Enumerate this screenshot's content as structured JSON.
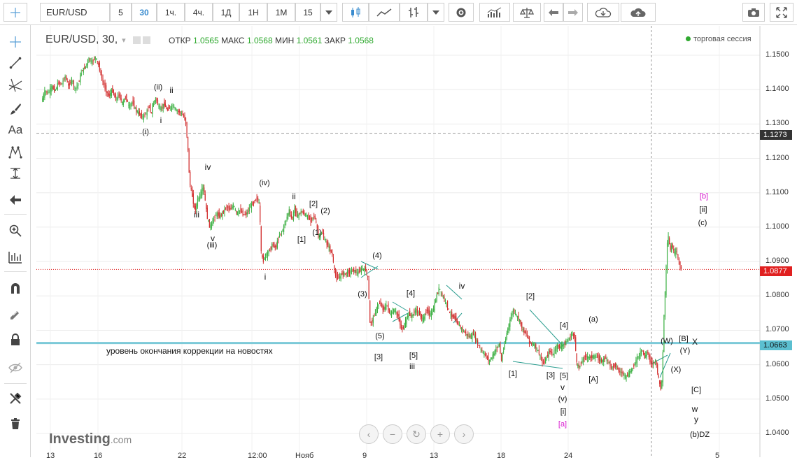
{
  "toolbar": {
    "symbol": "EUR/USD",
    "intervals": [
      "5",
      "30",
      "1ч.",
      "4ч.",
      "1Д",
      "1Н",
      "1М",
      "15"
    ],
    "active_interval": "30",
    "icons": [
      "interval-dropdown-icon",
      "candles-icon",
      "area-chart-icon",
      "bars-icon",
      "chart-style-dropdown-icon",
      "settings-icon",
      "indicators-icon",
      "compare-icon",
      "undo-icon",
      "redo-icon",
      "cloud-download-icon",
      "cloud-upload-icon",
      "camera-icon",
      "fullscreen-icon"
    ]
  },
  "sidebar": {
    "icons": [
      "crosshair-icon",
      "trend-line-icon",
      "fib-icon",
      "brush-icon",
      "text-icon",
      "pattern-icon",
      "measure-icon",
      "arrow-icon",
      "zoom-icon",
      "ruler-icon",
      "magnet-icon",
      "pencil-lock-icon",
      "lock-icon",
      "eye-icon",
      "remove-tools-icon",
      "trash-icon"
    ],
    "text_tool": "Aa"
  },
  "header": {
    "pair": "EUR/USD, 30,",
    "open_label": "ОТКР",
    "open": "1.0565",
    "high_label": "МАКС",
    "high": "1.0568",
    "low_label": "МИН",
    "low": "1.0561",
    "close_label": "ЗАКР",
    "close": "1.0568",
    "session": "торговая сессия"
  },
  "chart_data": {
    "type": "candlestick",
    "title": "EUR/USD, 30,",
    "ylim": [
      1.0375,
      1.1535
    ],
    "yticks": [
      "1.1500",
      "1.1400",
      "1.1300",
      "1.1200",
      "1.1100",
      "1.1000",
      "1.0900",
      "1.0800",
      "1.0700",
      "1.0600",
      "1.0500",
      "1.0400"
    ],
    "xticks": [
      "13",
      "16",
      "22",
      "12:00",
      "Нояб",
      "9",
      "13",
      "18",
      "24",
      "5"
    ],
    "price_levels": [
      {
        "value": 1.1273,
        "label": "1.1273",
        "color": "#333333",
        "style": "dashed-gray"
      },
      {
        "value": 1.0877,
        "label": "1.0877",
        "color": "#e02020",
        "style": "dotted-red"
      },
      {
        "value": 1.0663,
        "label": "1.0663",
        "color": "#5bbfd0",
        "style": "solid-cyan"
      }
    ],
    "annotation": "уровень окончания коррекции на новостях",
    "price_path": [
      [
        0,
        1.1365
      ],
      [
        5,
        1.1395
      ],
      [
        10,
        1.139
      ],
      [
        15,
        1.141
      ],
      [
        20,
        1.1395
      ],
      [
        25,
        1.142
      ],
      [
        30,
        1.1415
      ],
      [
        35,
        1.144
      ],
      [
        40,
        1.141
      ],
      [
        45,
        1.143
      ],
      [
        50,
        1.14
      ],
      [
        55,
        1.142
      ],
      [
        60,
        1.1455
      ],
      [
        65,
        1.1465
      ],
      [
        70,
        1.149
      ],
      [
        75,
        1.148
      ],
      [
        80,
        1.1495
      ],
      [
        85,
        1.147
      ],
      [
        90,
        1.143
      ],
      [
        95,
        1.14
      ],
      [
        100,
        1.138
      ],
      [
        105,
        1.14
      ],
      [
        110,
        1.137
      ],
      [
        115,
        1.1385
      ],
      [
        120,
        1.136
      ],
      [
        125,
        1.138
      ],
      [
        130,
        1.135
      ],
      [
        135,
        1.1365
      ],
      [
        140,
        1.134
      ],
      [
        145,
        1.133
      ],
      [
        150,
        1.132
      ],
      [
        155,
        1.133
      ],
      [
        160,
        1.135
      ],
      [
        163,
        1.133
      ],
      [
        166,
        1.136
      ],
      [
        170,
        1.1375
      ],
      [
        174,
        1.135
      ],
      [
        178,
        1.1345
      ],
      [
        182,
        1.136
      ],
      [
        186,
        1.134
      ],
      [
        190,
        1.1345
      ],
      [
        195,
        1.1355
      ],
      [
        200,
        1.134
      ],
      [
        205,
        1.1335
      ],
      [
        210,
        1.1325
      ],
      [
        214,
        1.131
      ],
      [
        217,
        1.1245
      ],
      [
        220,
        1.113
      ],
      [
        224,
        1.109
      ],
      [
        228,
        1.1045
      ],
      [
        232,
        1.108
      ],
      [
        236,
        1.1095
      ],
      [
        240,
        1.112
      ],
      [
        243,
        1.108
      ],
      [
        246,
        1.103
      ],
      [
        250,
        1.1
      ],
      [
        255,
        1.102
      ],
      [
        260,
        1.104
      ],
      [
        265,
        1.103
      ],
      [
        270,
        1.1045
      ],
      [
        275,
        1.106
      ],
      [
        280,
        1.105
      ],
      [
        285,
        1.1065
      ],
      [
        290,
        1.104
      ],
      [
        295,
        1.105
      ],
      [
        300,
        1.1035
      ],
      [
        305,
        1.104
      ],
      [
        310,
        1.106
      ],
      [
        315,
        1.107
      ],
      [
        320,
        1.1085
      ],
      [
        324,
        1.1065
      ],
      [
        326,
        1.093
      ],
      [
        329,
        1.09
      ],
      [
        333,
        1.092
      ],
      [
        338,
        1.093
      ],
      [
        343,
        1.095
      ],
      [
        348,
        1.094
      ],
      [
        353,
        1.0975
      ],
      [
        358,
        1.099
      ],
      [
        363,
        1.102
      ],
      [
        368,
        1.105
      ],
      [
        372,
        1.102
      ],
      [
        376,
        1.1055
      ],
      [
        380,
        1.103
      ],
      [
        385,
        1.1045
      ],
      [
        390,
        1.104
      ],
      [
        395,
        1.103
      ],
      [
        400,
        1.102
      ],
      [
        405,
        1.1035
      ],
      [
        408,
        1.101
      ],
      [
        412,
        1.097
      ],
      [
        417,
        1.0985
      ],
      [
        421,
        1.096
      ],
      [
        426,
        1.0945
      ],
      [
        432,
        1.092
      ],
      [
        436,
        1.086
      ],
      [
        441,
        1.085
      ],
      [
        446,
        1.0865
      ],
      [
        452,
        1.0865
      ],
      [
        458,
        1.087
      ],
      [
        464,
        1.0875
      ],
      [
        470,
        1.0865
      ],
      [
        476,
        1.088
      ],
      [
        482,
        1.0875
      ],
      [
        485,
        1.085
      ],
      [
        488,
        1.072
      ],
      [
        492,
        1.073
      ],
      [
        497,
        1.076
      ],
      [
        502,
        1.078
      ],
      [
        508,
        1.076
      ],
      [
        513,
        1.0775
      ],
      [
        518,
        1.0745
      ],
      [
        524,
        1.076
      ],
      [
        530,
        1.074
      ],
      [
        535,
        1.07
      ],
      [
        540,
        1.072
      ],
      [
        545,
        1.075
      ],
      [
        550,
        1.074
      ],
      [
        556,
        1.076
      ],
      [
        562,
        1.0745
      ],
      [
        567,
        1.073
      ],
      [
        572,
        1.076
      ],
      [
        577,
        1.0745
      ],
      [
        582,
        1.076
      ],
      [
        587,
        1.08
      ],
      [
        591,
        1.0825
      ],
      [
        595,
        1.08
      ],
      [
        599,
        1.079
      ],
      [
        603,
        1.077
      ],
      [
        607,
        1.0745
      ],
      [
        612,
        1.074
      ],
      [
        618,
        1.072
      ],
      [
        624,
        1.0705
      ],
      [
        630,
        1.069
      ],
      [
        636,
        1.068
      ],
      [
        642,
        1.069
      ],
      [
        648,
        1.066
      ],
      [
        654,
        1.064
      ],
      [
        660,
        1.0625
      ],
      [
        665,
        1.061
      ],
      [
        670,
        1.0625
      ],
      [
        675,
        1.0645
      ],
      [
        680,
        1.066
      ],
      [
        683,
        1.061
      ],
      [
        687,
        1.065
      ],
      [
        692,
        1.07
      ],
      [
        697,
        1.0735
      ],
      [
        701,
        1.076
      ],
      [
        705,
        1.0745
      ],
      [
        710,
        1.073
      ],
      [
        715,
        1.07
      ],
      [
        720,
        1.069
      ],
      [
        725,
        1.0665
      ],
      [
        730,
        1.066
      ],
      [
        735,
        1.065
      ],
      [
        740,
        1.063
      ],
      [
        745,
        1.06
      ],
      [
        750,
        1.062
      ],
      [
        755,
        1.064
      ],
      [
        760,
        1.063
      ],
      [
        765,
        1.0655
      ],
      [
        770,
        1.065
      ],
      [
        776,
        1.066
      ],
      [
        782,
        1.067
      ],
      [
        788,
        1.069
      ],
      [
        792,
        1.068
      ],
      [
        795,
        1.0605
      ],
      [
        798,
        1.059
      ],
      [
        803,
        1.061
      ],
      [
        808,
        1.0625
      ],
      [
        814,
        1.062
      ],
      [
        820,
        1.0625
      ],
      [
        826,
        1.062
      ],
      [
        832,
        1.061
      ],
      [
        838,
        1.062
      ],
      [
        842,
        1.061
      ],
      [
        847,
        1.059
      ],
      [
        852,
        1.06
      ],
      [
        858,
        1.058
      ],
      [
        864,
        1.0575
      ],
      [
        868,
        1.0565
      ],
      [
        873,
        1.0575
      ],
      [
        878,
        1.059
      ],
      [
        883,
        1.061
      ],
      [
        888,
        1.063
      ],
      [
        892,
        1.0645
      ],
      [
        896,
        1.062
      ],
      [
        900,
        1.064
      ],
      [
        904,
        1.061
      ],
      [
        908,
        1.06
      ],
      [
        912,
        1.0615
      ],
      [
        915,
        1.058
      ],
      [
        918,
        1.0545
      ],
      [
        921,
        1.0525
      ],
      [
        923,
        1.062
      ],
      [
        925,
        1.076
      ],
      [
        927,
        1.083
      ],
      [
        929,
        1.094
      ],
      [
        931,
        1.0975
      ],
      [
        934,
        1.093
      ],
      [
        937,
        1.095
      ],
      [
        940,
        1.092
      ],
      [
        943,
        1.094
      ],
      [
        946,
        1.09
      ],
      [
        949,
        1.088
      ]
    ],
    "wave_labels": [
      {
        "t": "(ii)",
        "x": 226,
        "p": 1.1405,
        "c": "k"
      },
      {
        "t": "ii",
        "x": 245,
        "p": 1.1398,
        "c": "k"
      },
      {
        "t": "i",
        "x": 230,
        "p": 1.131,
        "c": "k"
      },
      {
        "t": "(i)",
        "x": 208,
        "p": 1.1275,
        "c": "k"
      },
      {
        "t": "iv",
        "x": 297,
        "p": 1.1175,
        "c": "k"
      },
      {
        "t": "iii",
        "x": 281,
        "p": 1.1037,
        "c": "k"
      },
      {
        "t": "v",
        "x": 304,
        "p": 1.0967,
        "c": "k"
      },
      {
        "t": "(iii)",
        "x": 303,
        "p": 1.0945,
        "c": "k"
      },
      {
        "t": "(iv)",
        "x": 378,
        "p": 1.1125,
        "c": "k"
      },
      {
        "t": "i",
        "x": 379,
        "p": 1.0855,
        "c": "k"
      },
      {
        "t": "ii",
        "x": 420,
        "p": 1.109,
        "c": "k"
      },
      {
        "t": "[2]",
        "x": 448,
        "p": 1.1065,
        "c": "k"
      },
      {
        "t": "(2)",
        "x": 465,
        "p": 1.1045,
        "c": "k"
      },
      {
        "t": "(1)",
        "x": 453,
        "p": 1.0982,
        "c": "k"
      },
      {
        "t": "[1]",
        "x": 431,
        "p": 1.0962,
        "c": "k"
      },
      {
        "t": "(4)",
        "x": 539,
        "p": 1.0915,
        "c": "k"
      },
      {
        "t": "(3)",
        "x": 518,
        "p": 1.0802,
        "c": "k"
      },
      {
        "t": "[4]",
        "x": 587,
        "p": 1.0804,
        "c": "k"
      },
      {
        "t": "iv",
        "x": 660,
        "p": 1.083,
        "c": "k"
      },
      {
        "t": "(5)",
        "x": 543,
        "p": 1.068,
        "c": "k"
      },
      {
        "t": "[3]",
        "x": 541,
        "p": 1.062,
        "c": "k"
      },
      {
        "t": "[5]",
        "x": 591,
        "p": 1.0624,
        "c": "k"
      },
      {
        "t": "iii",
        "x": 589,
        "p": 1.0596,
        "c": "k"
      },
      {
        "t": "[2]",
        "x": 758,
        "p": 1.0797,
        "c": "k"
      },
      {
        "t": "[4]",
        "x": 806,
        "p": 1.0712,
        "c": "k"
      },
      {
        "t": "(a)",
        "x": 848,
        "p": 1.073,
        "c": "k"
      },
      {
        "t": "[1]",
        "x": 733,
        "p": 1.057,
        "c": "k"
      },
      {
        "t": "[3]",
        "x": 787,
        "p": 1.0566,
        "c": "k"
      },
      {
        "t": "[5]",
        "x": 806,
        "p": 1.0565,
        "c": "k"
      },
      {
        "t": "[A]",
        "x": 848,
        "p": 1.0555,
        "c": "k"
      },
      {
        "t": "v",
        "x": 804,
        "p": 1.0535,
        "c": "k"
      },
      {
        "t": "(v)",
        "x": 804,
        "p": 1.0497,
        "c": "k"
      },
      {
        "t": "[i]",
        "x": 805,
        "p": 1.0462,
        "c": "k"
      },
      {
        "t": "[a]",
        "x": 804,
        "p": 1.0425,
        "c": "p"
      },
      {
        "t": "[b]",
        "x": 1006,
        "p": 1.1088,
        "c": "p"
      },
      {
        "t": "[ii]",
        "x": 1005,
        "p": 1.1048,
        "c": "k"
      },
      {
        "t": "(c)",
        "x": 1004,
        "p": 1.101,
        "c": "k"
      },
      {
        "t": "(W)",
        "x": 953,
        "p": 1.0666,
        "c": "k"
      },
      {
        "t": "[B]",
        "x": 977,
        "p": 1.0673,
        "c": "k"
      },
      {
        "t": "(Y)",
        "x": 979,
        "p": 1.0638,
        "c": "k"
      },
      {
        "t": "X",
        "x": 993,
        "p": 1.0666,
        "c": "k"
      },
      {
        "t": "(X)",
        "x": 966,
        "p": 1.0583,
        "c": "k"
      },
      {
        "t": "[C]",
        "x": 995,
        "p": 1.0525,
        "c": "k"
      },
      {
        "t": "w",
        "x": 993,
        "p": 1.0472,
        "c": "k"
      },
      {
        "t": "y",
        "x": 995,
        "p": 1.0441,
        "c": "k"
      },
      {
        "t": "(b)DZ",
        "x": 1000,
        "p": 1.0393,
        "c": "k"
      }
    ],
    "grid": true
  },
  "watermark": {
    "brand": "Investing",
    "suffix": ".com"
  },
  "nav_controls": [
    "scroll-left-icon",
    "zoom-out-icon",
    "reset-icon",
    "zoom-in-icon",
    "scroll-right-icon"
  ]
}
